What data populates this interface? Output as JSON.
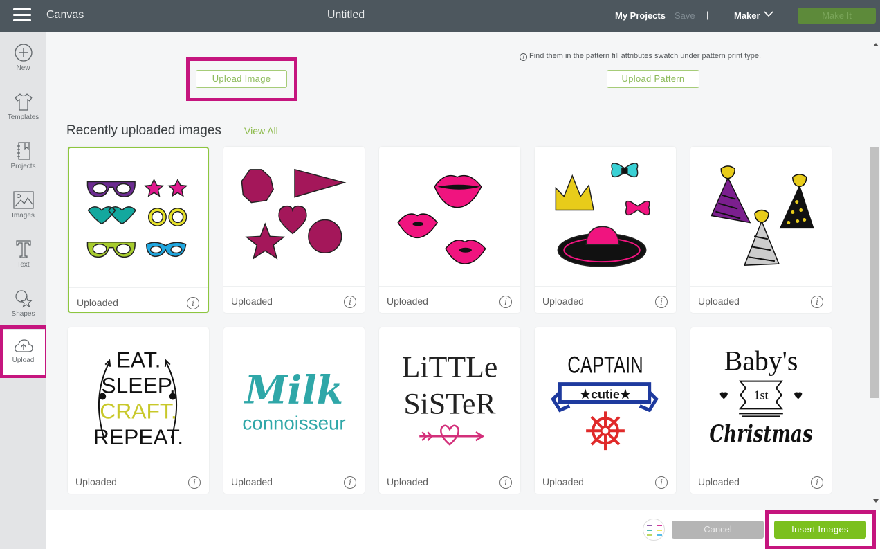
{
  "topbar": {
    "menu_icon": "hamburger-icon",
    "app_name": "Canvas",
    "document_title": "Untitled",
    "my_projects": "My Projects",
    "save": "Save",
    "separator": "|",
    "machine": "Maker",
    "machine_icon": "chevron-down-icon",
    "make_it": "Make It"
  },
  "sidebar": {
    "items": [
      {
        "label": "New",
        "icon": "plus-circle-icon"
      },
      {
        "label": "Templates",
        "icon": "tshirt-icon"
      },
      {
        "label": "Projects",
        "icon": "notebook-icon"
      },
      {
        "label": "Images",
        "icon": "image-icon"
      },
      {
        "label": "Text",
        "icon": "text-t-icon"
      },
      {
        "label": "Shapes",
        "icon": "shapes-icon"
      },
      {
        "label": "Upload",
        "icon": "cloud-upload-icon",
        "active": true
      }
    ]
  },
  "main": {
    "upload_image_label": "Upload Image",
    "pattern_note_icon": "info-icon",
    "pattern_note": "Find them in the pattern fill attributes swatch under pattern print type.",
    "upload_pattern_label": "Upload Pattern",
    "section_title": "Recently uploaded images",
    "view_all": "View All",
    "info_glyph": "i",
    "cards": [
      {
        "caption": "Uploaded",
        "content": "colorful glasses set",
        "selected": true
      },
      {
        "caption": "Uploaded",
        "content": "magenta shapes"
      },
      {
        "caption": "Uploaded",
        "content": "pink lips"
      },
      {
        "caption": "Uploaded",
        "content": "crown, bows and hat"
      },
      {
        "caption": "Uploaded",
        "content": "party hats"
      },
      {
        "caption": "Uploaded",
        "content": "EAT. SLEEP. CRAFT. REPEAT."
      },
      {
        "caption": "Uploaded",
        "content": "Milk connoisseur"
      },
      {
        "caption": "Uploaded",
        "content": "LiTTLe SiSTeR"
      },
      {
        "caption": "Uploaded",
        "content": "CAPTAIN cutie"
      },
      {
        "caption": "Uploaded",
        "content": "Baby's 1st Christmas"
      }
    ],
    "art_text": {
      "eat": "EAT.",
      "sleep": "SLEEP.",
      "craft": "CRAFT.",
      "repeat": "REPEAT.",
      "milk": "Milk",
      "connoisseur": "connoisseur",
      "little": "LiTTLe",
      "sister": "SiSTeR",
      "captain": "CAPTAIN",
      "cutie": "★cutie★",
      "babys": "Baby's",
      "first": "1st",
      "christmas": "Christmas"
    }
  },
  "footer": {
    "preview_icon": "selected-image-thumbnail",
    "cancel": "Cancel",
    "insert": "Insert Images"
  },
  "colors": {
    "topbar": "#4d575e",
    "accent_green": "#7bc01e",
    "highlight_magenta": "#c5157e",
    "make_it_green": "#5d8a3a"
  }
}
